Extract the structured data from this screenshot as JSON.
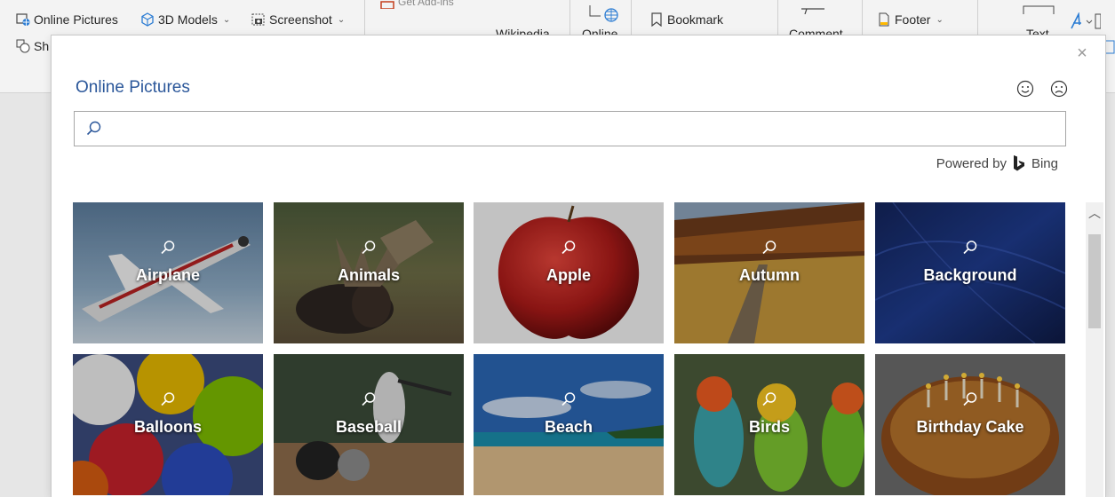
{
  "ribbon": {
    "online_pictures_label": "Online Pictures",
    "models_label": "3D Models",
    "screenshot_label": "Screenshot",
    "shapes_label": "Sh",
    "wikipedia_label": "Wikipedia",
    "online_label": "Online",
    "bookmark_label": "Bookmark",
    "comment_label": "Comment",
    "footer_label": "Footer",
    "text_label": "Text",
    "get_addins_label": "Get Add-ins"
  },
  "dialog": {
    "title": "Online Pictures",
    "close_icon": "close-icon",
    "feedback_positive": "smile-icon",
    "feedback_negative": "frown-icon",
    "search_placeholder": "",
    "powered_by": "Powered by",
    "provider": "Bing",
    "accent_color": "#2b579a"
  },
  "categories": [
    {
      "label": "Airplane"
    },
    {
      "label": "Animals"
    },
    {
      "label": "Apple"
    },
    {
      "label": "Autumn"
    },
    {
      "label": "Background"
    },
    {
      "label": "Balloons"
    },
    {
      "label": "Baseball"
    },
    {
      "label": "Beach"
    },
    {
      "label": "Birds"
    },
    {
      "label": "Birthday Cake"
    }
  ]
}
